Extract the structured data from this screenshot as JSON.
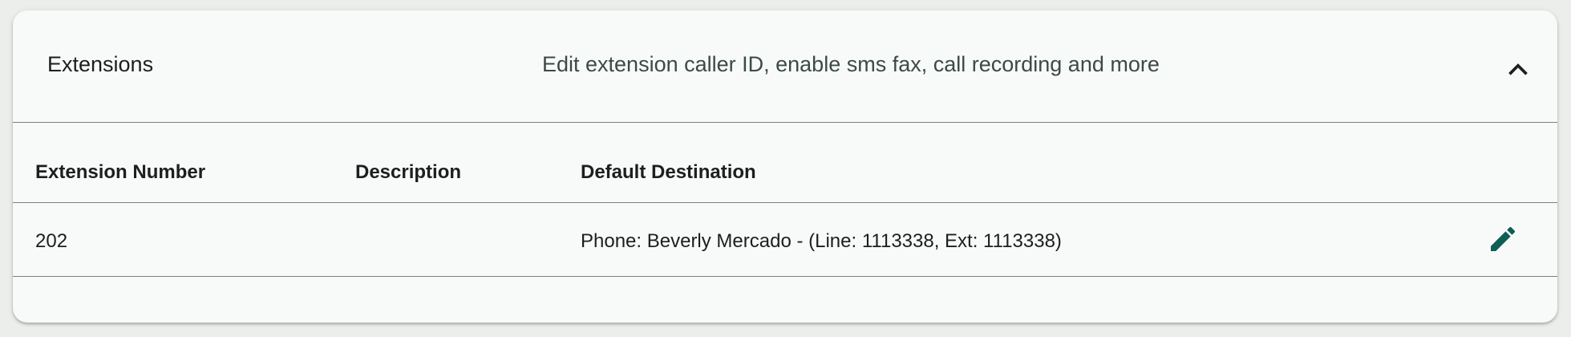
{
  "panel": {
    "title": "Extensions",
    "subtitle": "Edit extension caller ID, enable sms fax, call recording and more",
    "collapse_icon": "chevron-up-icon"
  },
  "table": {
    "columns": [
      "Extension Number",
      "Description",
      "Default Destination"
    ],
    "rows": [
      {
        "extension_number": "202",
        "description": "",
        "default_destination": "Phone: Beverly Mercado - (Line: 1113338, Ext: 1113338)",
        "action_icon": "pencil-icon"
      }
    ]
  },
  "colors": {
    "accent": "#0f5e55",
    "panel_bg": "#f8faf9",
    "page_bg": "#eceeeb"
  }
}
